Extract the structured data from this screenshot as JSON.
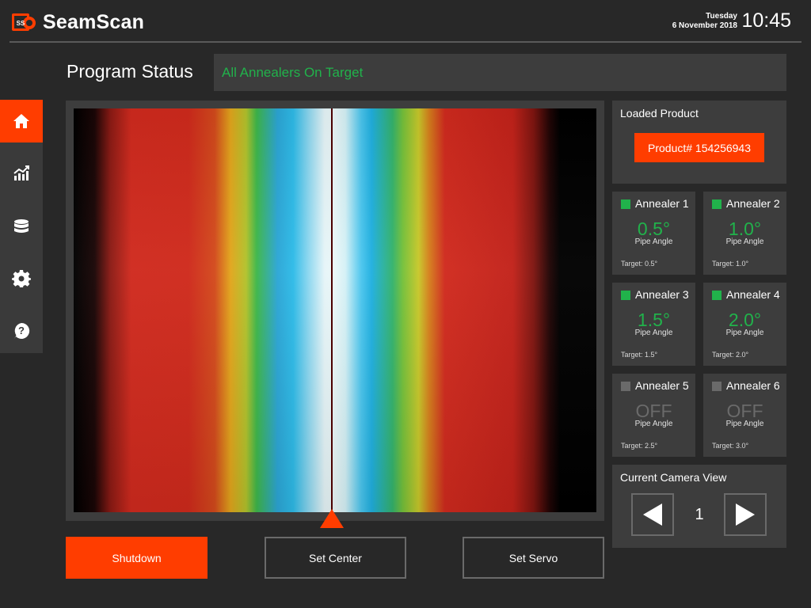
{
  "header": {
    "logo_text": "SS",
    "app_title": "SeamScan",
    "day": "Tuesday",
    "date": "6 November 2018",
    "time": "10:45"
  },
  "sidebar": {
    "items": [
      {
        "icon": "home-icon",
        "active": true
      },
      {
        "icon": "chart-icon",
        "active": false
      },
      {
        "icon": "database-icon",
        "active": false
      },
      {
        "icon": "gear-icon",
        "active": false
      },
      {
        "icon": "help-icon",
        "active": false
      }
    ]
  },
  "program_status": {
    "label": "Program Status",
    "message": "All Annealers On Target",
    "message_color": "#21b24b"
  },
  "actions": {
    "shutdown": "Shutdown",
    "set_center": "Set Center",
    "set_servo": "Set Servo"
  },
  "loaded_product": {
    "title": "Loaded Product",
    "product": "Product# 154256943"
  },
  "annealers": [
    {
      "name": "Annealer 1",
      "value": "0.5°",
      "label": "Pipe Angle",
      "target": "Target: 0.5°",
      "on": true
    },
    {
      "name": "Annealer 2",
      "value": "1.0°",
      "label": "Pipe Angle",
      "target": "Target: 1.0°",
      "on": true
    },
    {
      "name": "Annealer 3",
      "value": "1.5°",
      "label": "Pipe Angle",
      "target": "Target: 1.5°",
      "on": true
    },
    {
      "name": "Annealer 4",
      "value": "2.0°",
      "label": "Pipe Angle",
      "target": "Target: 2.0°",
      "on": true
    },
    {
      "name": "Annealer 5",
      "value": "OFF",
      "label": "Pipe Angle",
      "target": "Target: 2.5°",
      "on": false
    },
    {
      "name": "Annealer 6",
      "value": "OFF",
      "label": "Pipe Angle",
      "target": "Target: 3.0°",
      "on": false
    }
  ],
  "camera_view": {
    "title": "Current Camera View",
    "number": "1"
  },
  "colors": {
    "accent": "#ff3d00",
    "ok": "#21b24b",
    "background": "#282828",
    "panel": "#3d3d3d"
  }
}
